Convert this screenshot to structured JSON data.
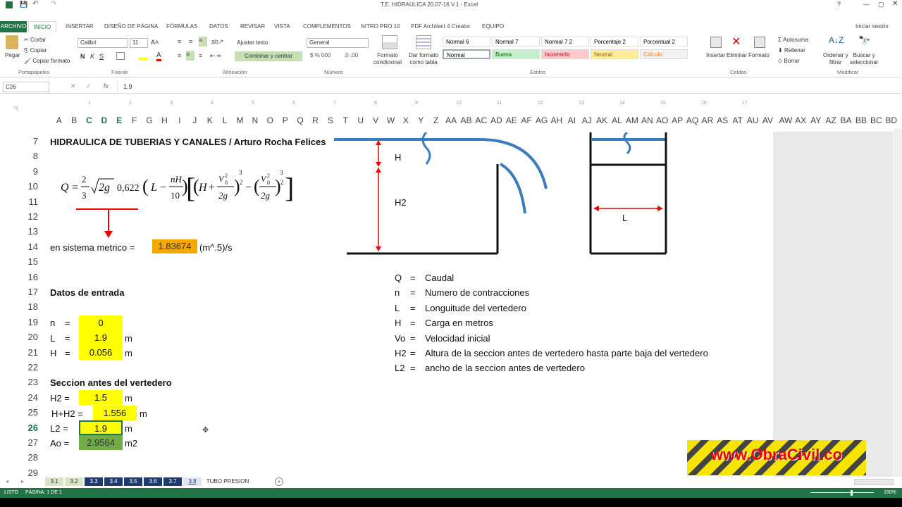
{
  "window": {
    "title": "T.E. HIDRAULICA 20.07-16 V.1 - Excel",
    "controls": [
      "?",
      "▭",
      "—",
      "▢",
      "✕"
    ]
  },
  "ribbon_tabs": {
    "archivo": "ARCHIVO",
    "inicio": "INICIO",
    "insertar": "INSERTAR",
    "diseno": "DISEÑO DE PÁGINA",
    "formulas": "FÓRMULAS",
    "datos": "DATOS",
    "revisar": "REVISAR",
    "vista": "VISTA",
    "complementos": "COMPLEMENTOS",
    "nitro": "NITRO PRO 10",
    "pdfarch": "PDF Architect 4 Creator",
    "equipo": "EQUIPO",
    "signin": "Iniciar sesión"
  },
  "ribbon": {
    "pegar": "Pegar",
    "cortar": "Cortar",
    "copiar": "Copiar",
    "copiar_formato": "Copiar formato",
    "portapapeles": "Portapapeles",
    "font_name": "Calibri",
    "font_size": "11",
    "fuente": "Fuente",
    "ajustar": "Ajustar texto",
    "combinar": "Combinar y centrar",
    "alineacion": "Alineación",
    "numfmt": "General",
    "numero": "Número",
    "formato_cond": "Formato\ncondicional",
    "dar_formato": "Dar formato\ncomo tabla",
    "styles": [
      {
        "name": "Normal 6",
        "bg": "#ffffff",
        "fg": "#000000"
      },
      {
        "name": "Normal 7",
        "bg": "#ffffff",
        "fg": "#000000"
      },
      {
        "name": "Normal 7 2",
        "bg": "#ffffff",
        "fg": "#000000"
      },
      {
        "name": "Porcentaje 2",
        "bg": "#ffffff",
        "fg": "#000000"
      },
      {
        "name": "Porcentual 2",
        "bg": "#ffffff",
        "fg": "#000000"
      },
      {
        "name": "Normal",
        "bg": "#ffffff",
        "fg": "#000000"
      },
      {
        "name": "Buena",
        "bg": "#c6efce",
        "fg": "#006100"
      },
      {
        "name": "Incorrecto",
        "bg": "#ffc7ce",
        "fg": "#9c0006"
      },
      {
        "name": "Neutral",
        "bg": "#ffeb9c",
        "fg": "#9c5700"
      },
      {
        "name": "Cálculo",
        "bg": "#f2f2f2",
        "fg": "#fa7d00"
      }
    ],
    "estilos": "Estilos",
    "insertar": "Insertar",
    "eliminar": "Eliminar",
    "formato": "Formato",
    "celdas": "Celdas",
    "autosuma": "Autosuma",
    "rellenar": "Rellenar",
    "borrar": "Borrar",
    "ordenar": "Ordenar y\nfiltrar",
    "buscar": "Buscar y\nseleccionar",
    "modificar": "Modificar"
  },
  "formula_bar": {
    "namebox": "C26",
    "fx": "fx",
    "value": "1.9"
  },
  "columns": [
    "A",
    "B",
    "C",
    "D",
    "E",
    "F",
    "G",
    "H",
    "I",
    "J",
    "K",
    "L",
    "M",
    "N",
    "O",
    "P",
    "Q",
    "R",
    "S",
    "T",
    "U",
    "V",
    "W",
    "X",
    "Y",
    "Z",
    "AA",
    "AB",
    "AC",
    "AD",
    "AE",
    "AF",
    "AG",
    "AH",
    "AI",
    "AJ",
    "AK",
    "AL",
    "AM",
    "AN",
    "AO",
    "AP",
    "AQ",
    "AR",
    "AS",
    "AT",
    "AU",
    "AV",
    "AW",
    "AX",
    "AY",
    "AZ",
    "BA",
    "BB",
    "BC",
    "BD"
  ],
  "ruler_marks": [
    "1",
    "2",
    "3",
    "4",
    "5",
    "6",
    "7",
    "8",
    "9",
    "10",
    "11",
    "12",
    "13",
    "14",
    "15",
    "16",
    "17"
  ],
  "rows": [
    "7",
    "8",
    "9",
    "10",
    "11",
    "12",
    "13",
    "14",
    "15",
    "16",
    "17",
    "18",
    "19",
    "20",
    "21",
    "22",
    "23",
    "24",
    "25",
    "26",
    "27",
    "28",
    "29"
  ],
  "sheet": {
    "title": "HIDRAULICA DE TUBERIAS Y CANALES / Arturo Rocha Felices",
    "formula": "Q = (2/3)·√(2g)·0,622·(L − nH/10)·[(H + V0²/2g)^(3/2) − (V0²/2g)^(3/2)]",
    "metric_label": "en sistema metrico =",
    "metric_value": "1.83674",
    "metric_unit": "(m^.5)/s",
    "datos_title": "Datos de entrada",
    "n_label": "n",
    "n_value": "0",
    "L_label": "L",
    "L_value": "1.9",
    "L_unit": "m",
    "H_label": "H",
    "H_value": "0.056",
    "H_unit": "m",
    "eq": "=",
    "seccion_title": "Seccion antes del vertedero",
    "H2_label": "H2 =",
    "H2_value": "1.5",
    "H2_unit": "m",
    "HH2_label": "H+H2 =",
    "HH2_value": "1.556",
    "HH2_unit": "m",
    "L2_label": "L2 =",
    "L2_value": "1.9",
    "L2_unit": "m",
    "Ao_label": "Ao =",
    "Ao_value": "2.9564",
    "Ao_unit": "m2",
    "legend": [
      {
        "sym": "Q",
        "desc": "Caudal"
      },
      {
        "sym": "n",
        "desc": "Numero de contracciones"
      },
      {
        "sym": "L",
        "desc": "Longuitude del vertedero"
      },
      {
        "sym": "H",
        "desc": "Carga en metros"
      },
      {
        "sym": "Vo",
        "desc": "Velocidad inicial"
      },
      {
        "sym": "H2",
        "desc": "Altura de la seccion antes de vertedero hasta parte baja del vertedero"
      },
      {
        "sym": "L2",
        "desc": "ancho de la seccion antes de vertedero"
      }
    ],
    "diagram_H": "H",
    "diagram_H2": "H2",
    "diagram_L": "L",
    "watermark": "www.ObraCivil.co"
  },
  "sheet_tabs": [
    "3.1",
    "3.2",
    "3.3",
    "3.4",
    "3.5",
    "3.6",
    "3.7",
    "3.8",
    "TUBO PRESION"
  ],
  "status": {
    "mode": "LISTO",
    "page": "PÁGINA: 1 DE 1",
    "zoom": "160%"
  }
}
